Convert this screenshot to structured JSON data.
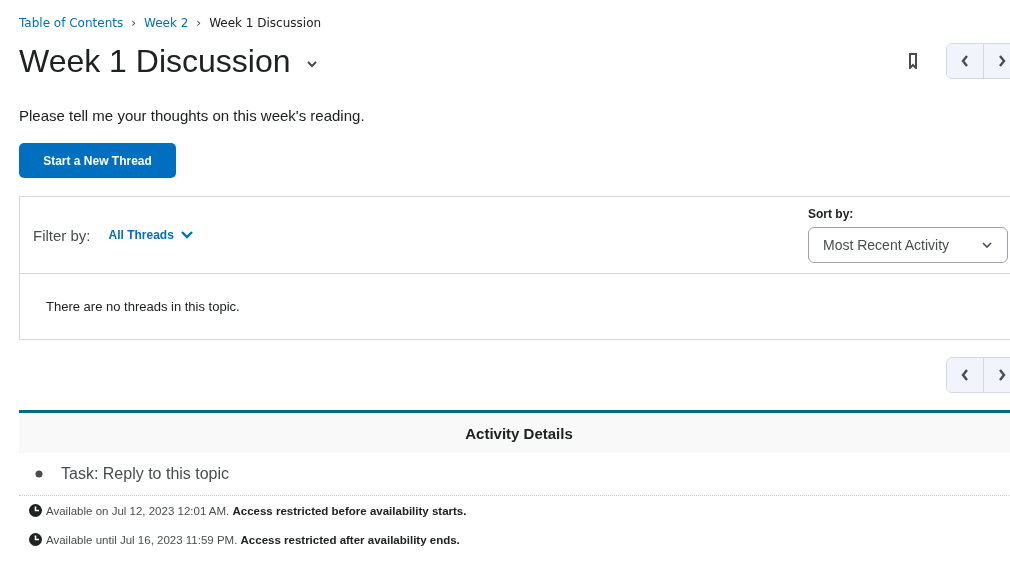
{
  "breadcrumb": [
    {
      "label": "Table of Contents",
      "kind": "link"
    },
    {
      "label": "Week 2",
      "kind": "link"
    },
    {
      "label": "Week 1 Discussion",
      "kind": "current"
    }
  ],
  "breadcrumb_separator": "›",
  "title": "Week 1 Discussion",
  "description": "Please tell me your thoughts on this week's reading.",
  "new_thread_button": "Start a New Thread",
  "filter": {
    "label": "Filter by:",
    "value": "All Threads"
  },
  "sort": {
    "label": "Sort by:",
    "value": "Most Recent Activity"
  },
  "empty_message": "There are no threads in this topic.",
  "activity": {
    "title": "Activity Details",
    "task": "Task: Reply to this topic",
    "availability": [
      "Available on Jul 12, 2023 12:01 AM. **Access restricted before availability starts.**",
      "Available until Jul 16, 2023 11:59 PM. **Access restricted after availability ends.**"
    ]
  }
}
